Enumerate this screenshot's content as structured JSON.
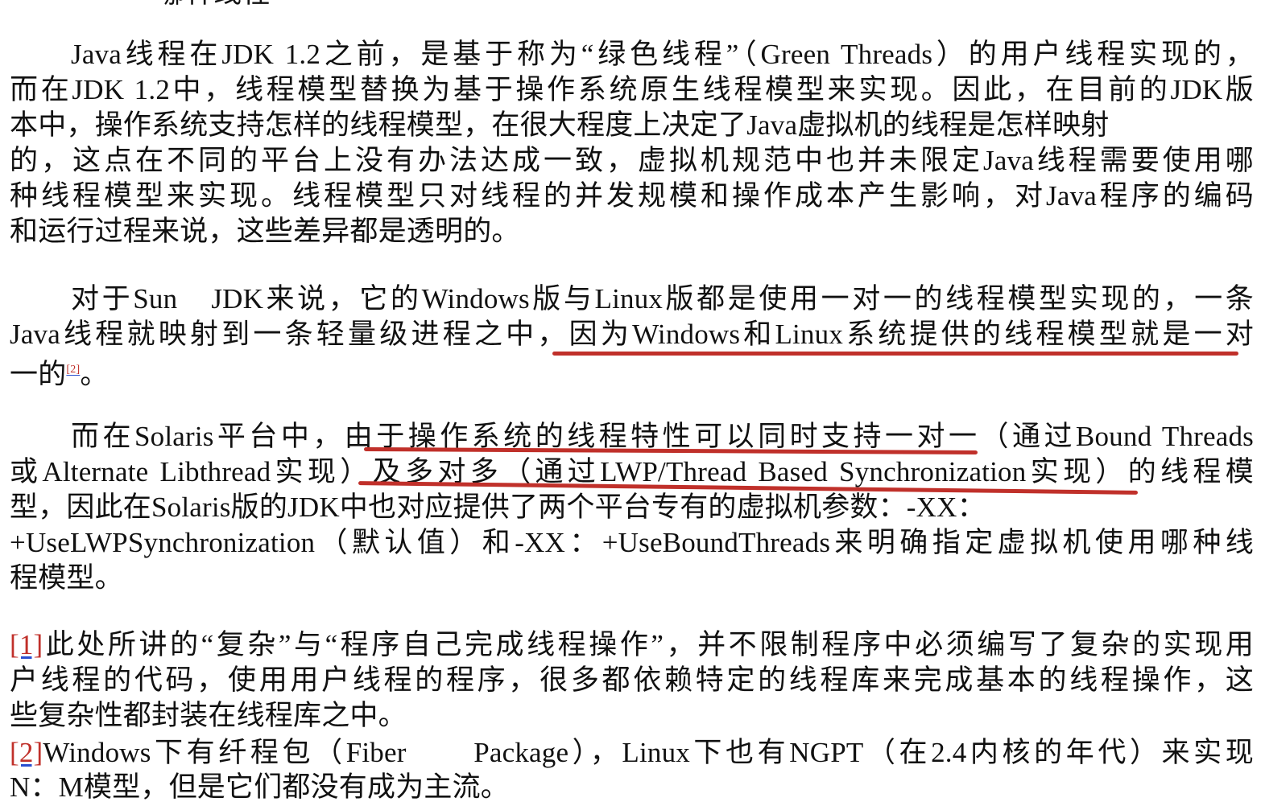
{
  "top_fragment": "哪种线程",
  "paragraph_1": {
    "lines": [
      "Java线程在JDK 1.2之前，是基于称为“绿色线程”（Green Threads）的用户线程实现的，",
      "而在JDK 1.2中，线程模型替换为基于操作系统原生线程模型来实现。因此，在目前的JDK版",
      "本中，操作系统支持怎样的线程模型，在很大程度上决定了Java虚拟机的线程是怎样映射",
      "的，这点在不同的平台上没有办法达成一致，虚拟机规范中也并未限定Java线程需要使用哪",
      "种线程模型来实现。线程模型只对线程的并发规模和操作成本产生影响，对Java程序的编码",
      "和运行过程来说，这些差异都是透明的。"
    ]
  },
  "paragraph_2": {
    "line_1": "对于Sun　JDK来说，它的Windows版与Linux版都是使用一对一的线程模型实现的，一条",
    "line_2": "Java线程就映射到一条轻量级进程之中，因为Windows和Linux系统提供的线程模型就是一对",
    "line_3_text": "一的",
    "line_3_ref": "[2]",
    "line_3_end": "。"
  },
  "paragraph_3": {
    "lines": [
      "而在Solaris平台中，由于操作系统的线程特性可以同时支持一对一（通过Bound Threads",
      "或Alternate Libthread实现）及多对多（通过LWP/Thread Based Synchronization实现）的线程模",
      "型，因此在Solaris版的JDK中也对应提供了两个平台专有的虚拟机参数：-XX：",
      "+UseLWPSynchronization（默认值）和-XX：+UseBoundThreads来明确指定虚拟机使用哪种线",
      "程模型。"
    ]
  },
  "footnote_1": {
    "ref": "[1]",
    "line_1": "此处所讲的“复杂”与“程序自己完成线程操作”，并不限制程序中必须编写了复杂的实现用",
    "line_2": "户线程的代码，使用用户线程的程序，很多都依赖特定的线程库来完成基本的线程操作，这",
    "line_3": "些复杂性都封装在线程库之中。"
  },
  "footnote_2": {
    "ref": "[2]",
    "line_1": "Windows下有纤程包（Fiber　　Package），Linux下也有NGPT（在2.4内核的年代）来实现",
    "line_2": "N：M模型，但是它们都没有成为主流。"
  },
  "annotation_color": "#c0302a",
  "link_color": "#c0302a"
}
